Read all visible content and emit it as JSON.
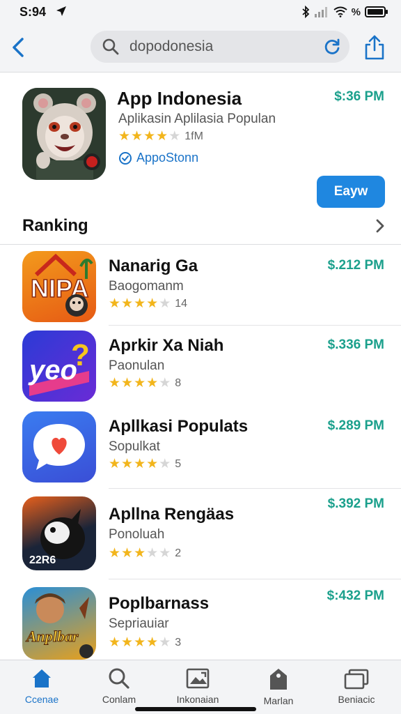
{
  "status_bar": {
    "time": "S:94",
    "battery_pct": "%"
  },
  "search": {
    "query": "dopodonesia"
  },
  "featured": {
    "title": "App Indonesia",
    "subtitle": "Aplikasin Aplilasia Populan",
    "rating": 3.5,
    "rating_count": "1fM",
    "verified_label": "AppoStonn",
    "price": "$:36 PM",
    "get_label": "Eayw"
  },
  "section": {
    "title": "Ranking"
  },
  "ranking": [
    {
      "name": "Nanarig Ga",
      "subtitle": "Baogomanm",
      "rating": 4,
      "count": "14",
      "price": "$.212 PM",
      "icon": "nipa-house-game-icon"
    },
    {
      "name": "Aprkir Xa Niah",
      "subtitle": "Paonulan",
      "rating": 3.5,
      "count": "8",
      "price": "$.336 PM",
      "icon": "yeo-chat-icon"
    },
    {
      "name": "Apllkasi Populats",
      "subtitle": "Sopulkat",
      "rating": 4,
      "count": "5",
      "price": "$.289 PM",
      "icon": "heart-chat-bubble-icon"
    },
    {
      "name": "Apllna Rengäas",
      "subtitle": "Ponoluah",
      "rating": 3,
      "count": "2",
      "price": "$.392 PM",
      "icon": "panda-game-icon"
    },
    {
      "name": "Poplbarnass",
      "subtitle": "Sepriauiar",
      "rating": 4,
      "count": "3",
      "price": "$:432 PM",
      "icon": "anplbar-game-icon"
    }
  ],
  "icon_texts": {
    "nipa": "NIPA",
    "yeo": "yeo",
    "game4": "22R6",
    "game5": "Anplbar"
  },
  "tabs": [
    {
      "label": "Ccenae",
      "icon": "home-icon",
      "active": true
    },
    {
      "label": "Conlam",
      "icon": "search-icon",
      "active": false
    },
    {
      "label": "Inkonaian",
      "icon": "image-card-icon",
      "active": false
    },
    {
      "label": "Marlan",
      "icon": "tag-icon",
      "active": false
    },
    {
      "label": "Beniacic",
      "icon": "stack-icon",
      "active": false
    }
  ],
  "colors": {
    "accent": "#1f87e0",
    "price": "#1ba08c",
    "star": "#f2b51c"
  }
}
